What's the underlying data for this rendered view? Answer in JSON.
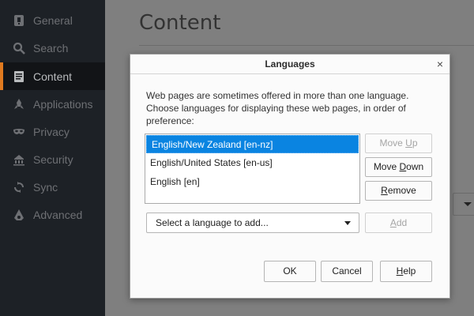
{
  "sidebar": {
    "items": [
      {
        "label": "General",
        "icon": "general-icon",
        "active": false
      },
      {
        "label": "Search",
        "icon": "search-icon",
        "active": false
      },
      {
        "label": "Content",
        "icon": "content-icon",
        "active": true
      },
      {
        "label": "Applications",
        "icon": "applications-icon",
        "active": false
      },
      {
        "label": "Privacy",
        "icon": "privacy-mask-icon",
        "active": false
      },
      {
        "label": "Security",
        "icon": "security-icon",
        "active": false
      },
      {
        "label": "Sync",
        "icon": "sync-icon",
        "active": false
      },
      {
        "label": "Advanced",
        "icon": "advanced-icon",
        "active": false
      }
    ],
    "accent_color": "#e07a1f"
  },
  "main": {
    "title": "Content"
  },
  "dialog": {
    "title": "Languages",
    "close": "×",
    "description": "Web pages are sometimes offered in more than one language. Choose languages for displaying these web pages, in order of preference:",
    "languages": [
      {
        "label": "English/New Zealand  [en-nz]",
        "selected": true
      },
      {
        "label": "English/United States  [en-us]",
        "selected": false
      },
      {
        "label": "English  [en]",
        "selected": false
      }
    ],
    "buttons": {
      "move_up": {
        "pre": "Move ",
        "accel": "U",
        "post": "p",
        "disabled": true
      },
      "move_down": {
        "pre": "Move ",
        "accel": "D",
        "post": "own",
        "disabled": false
      },
      "remove": {
        "pre": "",
        "accel": "R",
        "post": "emove",
        "disabled": false
      },
      "add": {
        "pre": "",
        "accel": "A",
        "post": "dd",
        "disabled": true
      },
      "ok": "OK",
      "cancel": "Cancel",
      "help": {
        "pre": "",
        "accel": "H",
        "post": "elp"
      }
    },
    "add_select": {
      "value": "Select a language to add..."
    },
    "selection_color": "#0a84e1"
  }
}
